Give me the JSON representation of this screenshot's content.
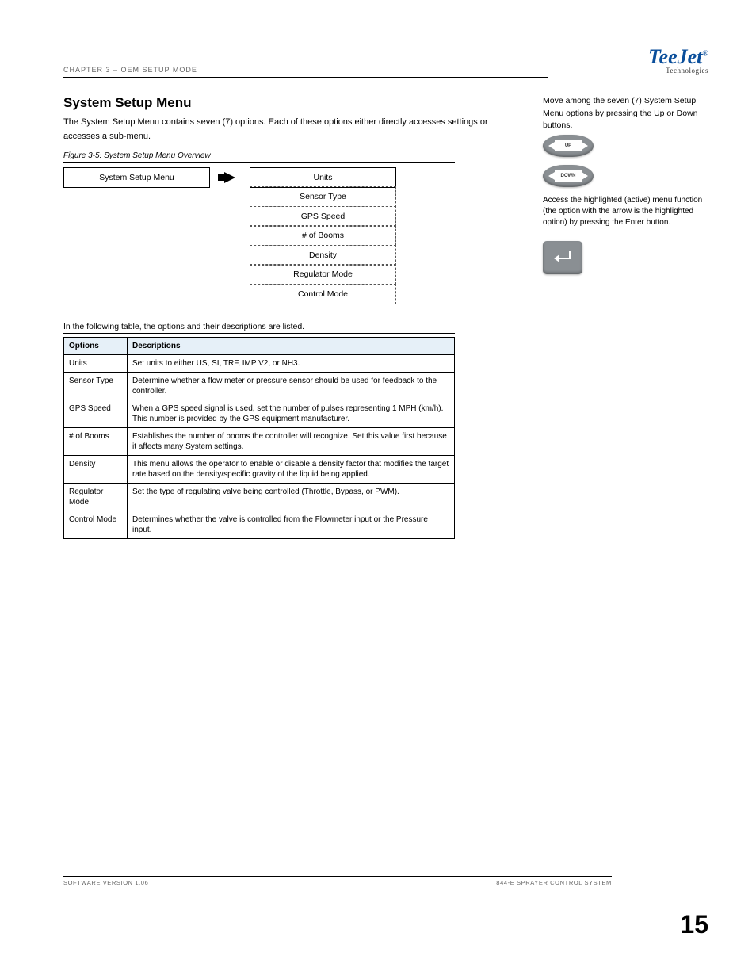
{
  "header": {
    "chapter": "CHAPTER 3 – OEM SETUP MODE",
    "logo": "TeeJet",
    "logo_sub": "Technologies"
  },
  "section": {
    "title": "System Setup Menu",
    "intro": "The System Setup Menu contains seven (7) options. Each of these options either directly accesses settings or accesses a sub-menu.",
    "fig_caption": "Figure 3-5: System Setup Menu Overview",
    "menu_root": "System Setup Menu",
    "menu_items": [
      "Units",
      "Sensor Type",
      "GPS Speed",
      "# of Booms",
      "Density",
      "Regulator Mode",
      "Control Mode"
    ]
  },
  "table": {
    "caption": "In the following table, the options and their descriptions are listed.",
    "headers": {
      "opt": "Options",
      "desc": "Descriptions"
    },
    "rows": [
      {
        "opt": "Units",
        "desc": "Set units to either US, SI, TRF, IMP V2, or NH3."
      },
      {
        "opt": "Sensor Type",
        "desc": "Determine whether a flow meter or pressure sensor should be used for feedback to the controller."
      },
      {
        "opt": "GPS Speed",
        "desc": "When a GPS speed signal is used, set the number of pulses representing 1 MPH (km/h). This number is provided by the GPS equipment manufacturer."
      },
      {
        "opt": "# of Booms",
        "desc": "Establishes the number of booms the controller will recognize. Set this value first because it affects many System settings."
      },
      {
        "opt": "Density",
        "desc": "This menu allows the operator to enable or disable a density factor that modifies the target rate based on the density/specific gravity of the liquid being applied."
      },
      {
        "opt": "Regulator Mode",
        "desc": "Set the type of regulating valve being controlled (Throttle, Bypass, or PWM)."
      },
      {
        "opt": "Control Mode",
        "desc": "Determines whether the valve is controlled from the Flowmeter input or the Pressure input."
      }
    ]
  },
  "sidebar": {
    "move_text": "Move among the seven (7) System Setup Menu options by pressing the Up or Down buttons.",
    "access_text": "Access the highlighted (active) menu function (the option with the arrow is the highlighted option) by pressing the Enter button.",
    "up_label": "UP",
    "down_label": "DOWN"
  },
  "footer": {
    "left": "SOFTWARE VERSION 1.06",
    "right": "844-E SPRAYER CONTROL SYSTEM",
    "page": "15"
  }
}
